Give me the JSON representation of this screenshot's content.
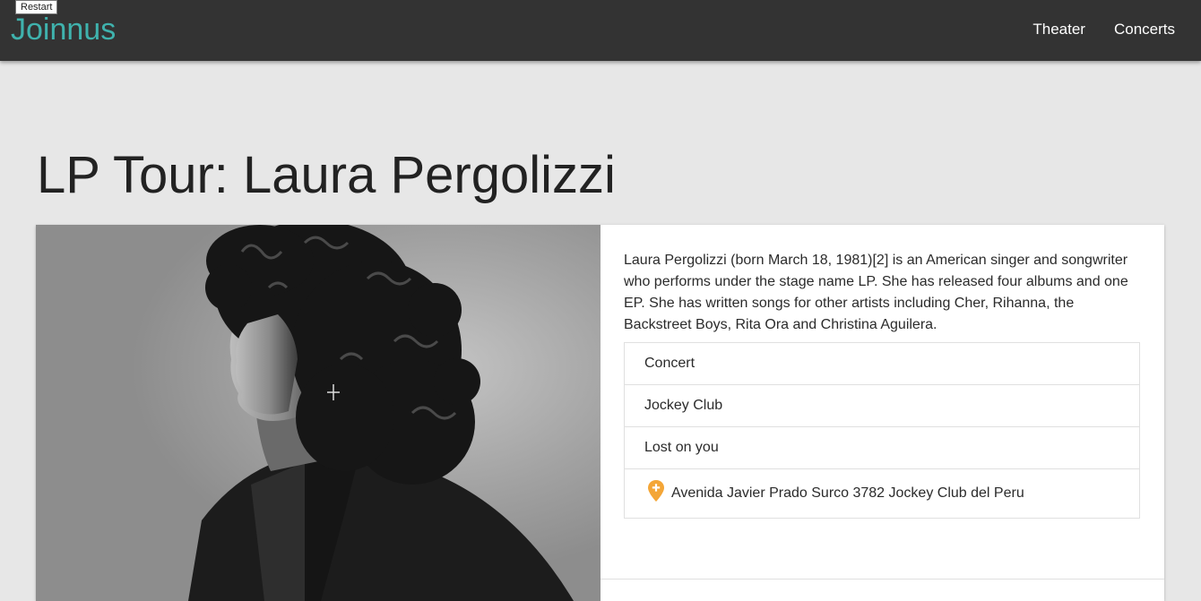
{
  "tooltip": {
    "label": "Restart"
  },
  "navbar": {
    "brand": "Joinnus",
    "links": [
      "Theater",
      "Concerts"
    ],
    "brand_color": "#3fb2ad",
    "background": "#333333"
  },
  "event": {
    "title": "LP Tour: Laura Pergolizzi",
    "description": "Laura Pergolizzi (born March 18, 1981)[2] is an American singer and songwriter who performs under the stage name LP. She has released four albums and one EP. She has written songs for other artists including Cher, Rihanna, the Backstreet Boys, Rita Ora and Christina Aguilera.",
    "details": {
      "category": "Concert",
      "venue": "Jockey Club",
      "song": "Lost on you",
      "address": "Avenida Javier Prado Surco 3782 Jockey Club del Peru"
    },
    "image_icon": "portrait-photo",
    "pin_icon": "map-pin-icon",
    "pin_color": "#f4a637"
  }
}
